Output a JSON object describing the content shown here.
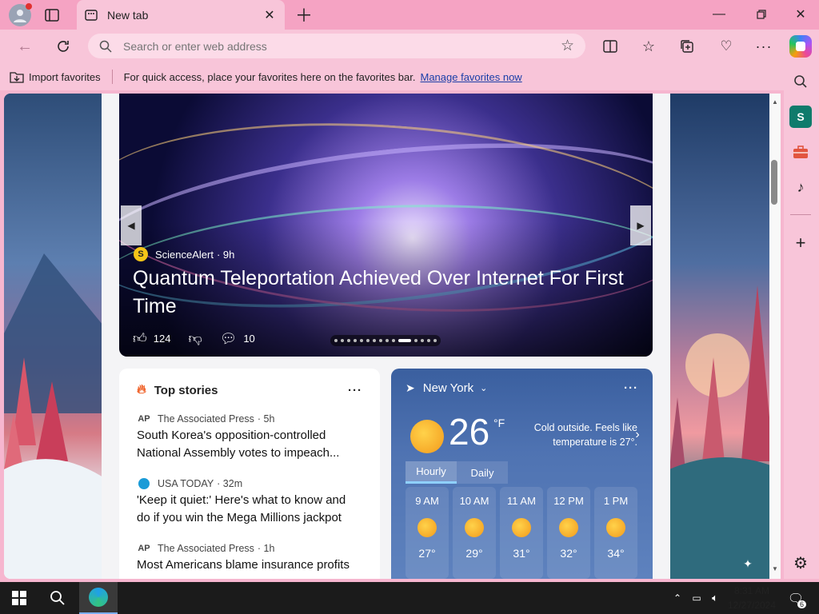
{
  "tab": {
    "title": "New tab"
  },
  "address_bar": {
    "placeholder": "Search or enter web address"
  },
  "favorites_bar": {
    "import_label": "Import favorites",
    "message": "For quick access, place your favorites here on the favorites bar.",
    "manage_link": "Manage favorites now"
  },
  "hero": {
    "source": "ScienceAlert",
    "source_logo": "S",
    "age": "· 9h",
    "title": "Quantum Teleportation Achieved Over Internet For First Time",
    "likes": "124",
    "comments": "10",
    "slide_count": 15,
    "active_slide": 10
  },
  "top_stories": {
    "title": "Top stories",
    "items": [
      {
        "source": "The Associated Press",
        "age": "· 5h",
        "logo": "AP",
        "title": "South Korea's opposition-controlled National Assembly votes to impeach..."
      },
      {
        "source": "USA TODAY",
        "age": "· 32m",
        "logo": "",
        "title": "'Keep it quiet:' Here's what to know and do if you win the Mega Millions jackpot"
      },
      {
        "source": "The Associated Press",
        "age": "· 1h",
        "logo": "AP",
        "title": "Most Americans blame insurance profits"
      }
    ]
  },
  "weather": {
    "location": "New York",
    "temperature": "26",
    "unit": "°F",
    "note": "Cold outside. Feels like temperature is 27°.",
    "tabs": [
      "Hourly",
      "Daily"
    ],
    "active_tab": "Hourly",
    "hours": [
      {
        "time": "9 AM",
        "temp": "27°"
      },
      {
        "time": "10 AM",
        "temp": "29°"
      },
      {
        "time": "11 AM",
        "temp": "31°"
      },
      {
        "time": "12 PM",
        "temp": "32°"
      },
      {
        "time": "1 PM",
        "temp": "34°"
      }
    ]
  },
  "taskbar": {
    "time": "8:31 AM",
    "date": "12/27/2024",
    "notification_count": "6"
  },
  "colors": {
    "accent_pink": "#f5a3c3",
    "toolbar_pink": "#f8c5d9",
    "link_blue": "#1a3fa8",
    "weather_blue": "#4f73b2"
  }
}
